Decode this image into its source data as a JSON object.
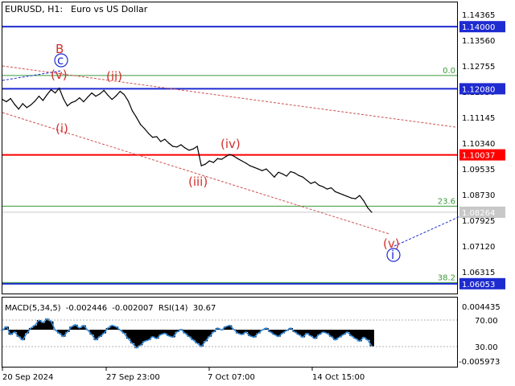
{
  "header": {
    "symbol_timeframe": "EURUSD, H1:",
    "description": "Euro vs US Dollar"
  },
  "colors": {
    "price": "#000000",
    "blue_level": "#1e2bd0",
    "red_level": "#ff0000",
    "fib_line": "#3a9a3a",
    "fib_text": "#3a9a3a",
    "wave_label": "#d0302c",
    "wave_circle_label": "#1e2bd0",
    "channel_dashed": "#d05050",
    "projection_dashed": "#1e2bd0",
    "macd_histogram": "#000000",
    "rsi_line": "#2f8be0",
    "axis_box_blue": "#1e2bd0",
    "axis_box_red": "#ff0000",
    "axis_box_gray": "#c8c8c8"
  },
  "chart_data": [
    {
      "type": "line",
      "title": "EURUSD, H1: Euro vs US Dollar",
      "y_axis_ticks": [
        "1.14365",
        "1.13560",
        "1.12755",
        "1.11950",
        "1.11145",
        "1.10340",
        "1.09535",
        "1.08730",
        "1.07925",
        "1.07120",
        "1.06315"
      ],
      "ylim": [
        1.0575,
        1.1475
      ],
      "x_axis_ticks": [
        "20 Sep 2024",
        "27 Sep 23:00",
        "7 Oct 07:00",
        "14 Oct 15:00"
      ],
      "series": [
        {
          "values": [
            1.1175,
            1.1168,
            1.1178,
            1.116,
            1.1145,
            1.1162,
            1.115,
            1.1158,
            1.117,
            1.1185,
            1.1172,
            1.119,
            1.1205,
            1.1195,
            1.121,
            1.1178,
            1.1155,
            1.1165,
            1.117,
            1.118,
            1.1168,
            1.1182,
            1.1195,
            1.1185,
            1.1192,
            1.1203,
            1.1188,
            1.1175,
            1.1186,
            1.12,
            1.119,
            1.117,
            1.114,
            1.112,
            1.1098,
            1.1085,
            1.107,
            1.1058,
            1.106,
            1.1045,
            1.1052,
            1.104,
            1.103,
            1.1028,
            1.1035,
            1.1025,
            1.1018,
            1.1022,
            1.103,
            1.097,
            1.0975,
            1.0985,
            1.098,
            1.0992,
            1.099,
            1.0998,
            1.1005,
            1.1,
            1.0992,
            1.0985,
            1.0978,
            1.097,
            1.0965,
            1.096,
            1.0955,
            1.096,
            1.0948,
            1.0935,
            1.095,
            1.0945,
            1.0938,
            1.0952,
            1.0948,
            1.094,
            1.0935,
            1.0925,
            1.0915,
            1.092,
            1.091,
            1.0905,
            1.0898,
            1.0902,
            1.089,
            1.0885,
            1.088,
            1.0875,
            1.087,
            1.0868,
            1.0878,
            1.0862,
            1.084,
            1.0826
          ]
        }
      ],
      "horizontal_levels": [
        {
          "value": 1.14,
          "label": "1.14000",
          "style": "blue"
        },
        {
          "value": 1.1208,
          "label": "1.12080",
          "style": "blue"
        },
        {
          "value": 1.10037,
          "label": "1.10037",
          "style": "red"
        },
        {
          "value": 1.08264,
          "label": "1.08264",
          "style": "gray"
        },
        {
          "value": 1.06053,
          "label": "1.06053",
          "style": "blue"
        }
      ],
      "fibonacci": [
        {
          "label": "0.0",
          "value": 1.1249
        },
        {
          "label": "23.6",
          "value": 1.0845
        },
        {
          "label": "38.2",
          "value": 1.0609
        }
      ],
      "wave_labels": [
        "B",
        "(v)",
        "(ii)",
        "(i)",
        "(iv)",
        "(iii)",
        "(v)"
      ],
      "wave_circle_labels": [
        "c",
        "i"
      ]
    },
    {
      "type": "line",
      "title": "MACD(5,34,5) -0.002446 -0.002007 RSI(14) 30.67",
      "indicator_labels": {
        "macd_name": "MACD(5,34,5)",
        "macd_main": "-0.002446",
        "macd_signal": "-0.002007",
        "rsi_name": "RSI(14)",
        "rsi_value": "30.67"
      },
      "y_axis_ticks": [
        "0.004435",
        "70.00",
        "30.00",
        "-0.005973"
      ],
      "series": [
        {
          "name": "RSI(14)",
          "values": [
            55,
            60,
            48,
            52,
            45,
            40,
            50,
            58,
            62,
            70,
            66,
            72,
            68,
            55,
            50,
            45,
            52,
            60,
            63,
            58,
            62,
            55,
            48,
            40,
            45,
            50,
            58,
            62,
            60,
            55,
            50,
            42,
            35,
            28,
            32,
            38,
            40,
            45,
            42,
            48,
            50,
            46,
            44,
            52,
            56,
            50,
            45,
            40,
            35,
            30,
            38,
            45,
            52,
            58,
            55,
            60,
            62,
            56,
            50,
            48,
            52,
            46,
            44,
            50,
            55,
            58,
            52,
            48,
            45,
            50,
            54,
            58,
            52,
            48,
            44,
            50,
            46,
            42,
            48,
            52,
            50,
            45,
            40,
            44,
            48,
            52,
            46,
            42,
            38,
            44,
            40,
            30.67
          ]
        }
      ]
    }
  ]
}
